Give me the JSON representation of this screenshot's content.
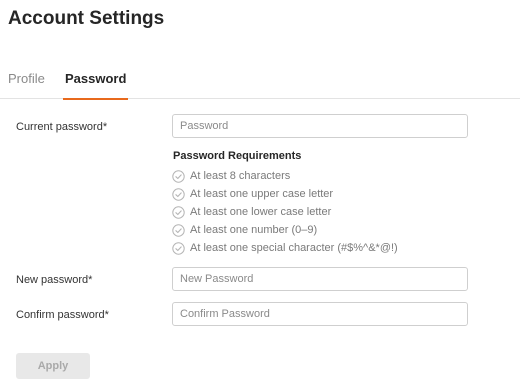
{
  "page": {
    "title": "Account Settings"
  },
  "tabs": [
    {
      "label": "Profile",
      "active": false
    },
    {
      "label": "Password",
      "active": true
    }
  ],
  "form": {
    "current_password": {
      "label": "Current password*",
      "placeholder": "Password",
      "value": ""
    },
    "requirements": {
      "title": "Password Requirements",
      "items": [
        "At least 8 characters",
        "At least one upper case letter",
        "At least one lower case letter",
        "At least one number (0–9)",
        "At least one special character (#$%^&*@!)"
      ]
    },
    "new_password": {
      "label": "New password*",
      "placeholder": "New Password",
      "value": ""
    },
    "confirm_password": {
      "label": "Confirm password*",
      "placeholder": "Confirm Password",
      "value": ""
    },
    "apply_label": "Apply"
  },
  "colors": {
    "accent": "#e8691c",
    "check_icon": "#b5b5b5",
    "disabled_button_bg": "#e8e8e8"
  },
  "icons": {
    "requirement": "check-circle-icon"
  }
}
